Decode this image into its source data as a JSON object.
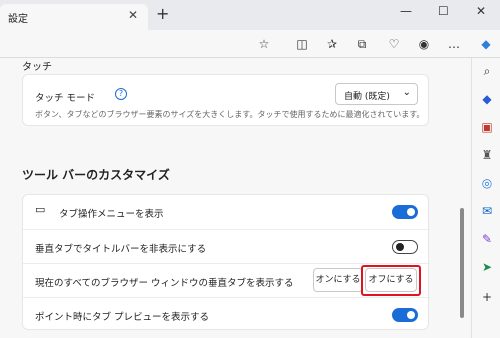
{
  "tab": {
    "title": "設定",
    "close": "✕",
    "new": "+"
  },
  "window": {
    "minimize": "—",
    "maximize": "☐",
    "close": "✕"
  },
  "toolbar": {
    "more": "…"
  },
  "sections": {
    "touch": {
      "heading": "タッチ",
      "mode_label": "タッチ モード",
      "help": "?",
      "mode_value": "自動 (既定)",
      "description": "ボタン、タブなどのブラウザー要素のサイズを大きくします。タッチで使用するために最適化されています。"
    },
    "toolbar_customize": {
      "heading": "ツール バーのカスタマイズ",
      "rows": [
        {
          "label": "タブ操作メニューを表示",
          "toggle": "on"
        },
        {
          "label": "垂直タブでタイトルバーを非表示にする",
          "toggle": "off"
        },
        {
          "label": "現在のすべてのブラウザー ウィンドウの垂直タブを表示する",
          "on_button": "オンにする",
          "off_button": "オフにする"
        },
        {
          "label": "ポイント時にタブ プレビューを表示する",
          "toggle": "on"
        }
      ]
    }
  },
  "colors": {
    "accent": "#1a6dd6",
    "highlight": "#e0141e"
  }
}
